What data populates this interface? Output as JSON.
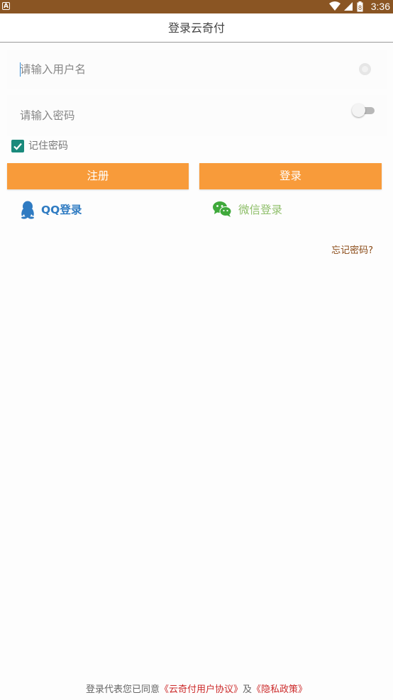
{
  "status_bar": {
    "app_glyph": "A",
    "time": "3:36",
    "battery_glyph": "8"
  },
  "app_bar": {
    "title": "登录云奇付"
  },
  "form": {
    "username_placeholder": "请输入用户名",
    "password_placeholder": "请输入密码",
    "remember_label": "记住密码",
    "remember_checked": true,
    "password_visible": false
  },
  "buttons": {
    "register": "注册",
    "login": "登录"
  },
  "social": {
    "qq_label": "QQ登录",
    "wechat_label": "微信登录"
  },
  "forgot_label": "忘记密码?",
  "agreement": {
    "prefix": "登录代表您已同意",
    "user_agreement": "《云奇付用户协议》",
    "joiner": "及",
    "privacy_policy": "《隐私政策》"
  },
  "colors": {
    "status_bar": "#8a5523",
    "accent_orange": "#f89b3a",
    "checkbox_teal": "#1a8a7c",
    "qq_blue": "#2f7bc2",
    "wechat_green": "#8fbf6a",
    "link_red": "#cc2b2b"
  }
}
